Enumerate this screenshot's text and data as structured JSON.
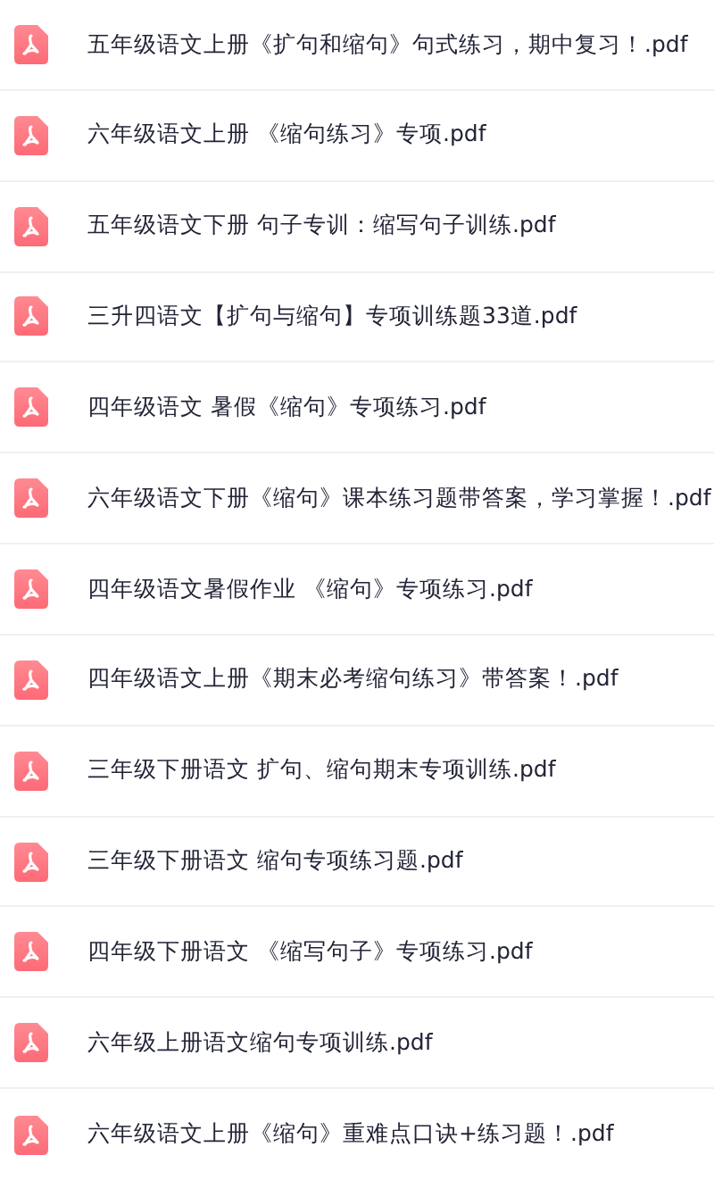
{
  "files": [
    {
      "name": "五年级语文上册《扩句和缩句》句式练习，期中复习！.pdf"
    },
    {
      "name": "六年级语文上册 《缩句练习》专项.pdf"
    },
    {
      "name": "五年级语文下册 句子专训：缩写句子训练.pdf"
    },
    {
      "name": "三升四语文【扩句与缩句】专项训练题33道.pdf"
    },
    {
      "name": "四年级语文 暑假《缩句》专项练习.pdf"
    },
    {
      "name": "六年级语文下册《缩句》课本练习题带答案，学习掌握！.pdf"
    },
    {
      "name": "四年级语文暑假作业 《缩句》专项练习.pdf"
    },
    {
      "name": "四年级语文上册《期末必考缩句练习》带答案！.pdf"
    },
    {
      "name": "三年级下册语文 扩句、缩句期末专项训练.pdf"
    },
    {
      "name": "三年级下册语文 缩句专项练习题.pdf"
    },
    {
      "name": "四年级下册语文 《缩写句子》专项练习.pdf"
    },
    {
      "name": "六年级上册语文缩句专项训练.pdf"
    },
    {
      "name": "六年级语文上册《缩句》重难点口诀+练习题！.pdf"
    }
  ]
}
